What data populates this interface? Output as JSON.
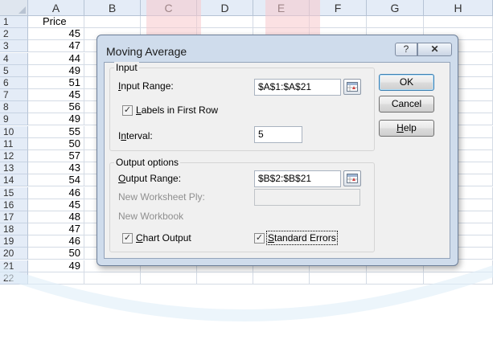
{
  "sheet": {
    "columns": [
      "A",
      "B",
      "C",
      "D",
      "E",
      "F",
      "G",
      "H"
    ],
    "rows": [
      "1",
      "2",
      "3",
      "4",
      "5",
      "6",
      "7",
      "8",
      "9",
      "10",
      "11",
      "12",
      "13",
      "14",
      "15",
      "16",
      "17",
      "18",
      "19",
      "20",
      "21",
      "22"
    ],
    "column_a": [
      "Price",
      "45",
      "47",
      "44",
      "49",
      "51",
      "45",
      "56",
      "49",
      "55",
      "50",
      "57",
      "43",
      "54",
      "46",
      "45",
      "48",
      "47",
      "46",
      "50",
      "49",
      ""
    ]
  },
  "dialog": {
    "title": "Moving Average",
    "help_glyph": "?",
    "close_glyph": "✕",
    "input": {
      "group_label": "Input",
      "range_label": "Input Range:",
      "range_value": "$A$1:$A$21",
      "labels_first_row_label": "Labels in First Row",
      "labels_first_row_checked": true,
      "interval_label": "Interval:",
      "interval_value": "5"
    },
    "output": {
      "group_label": "Output options",
      "range_label": "Output Range:",
      "range_value": "$B$2:$B$21",
      "new_ply_label": "New Worksheet Ply:",
      "new_workbook_label": "New Workbook",
      "chart_output_label": "Chart Output",
      "chart_output_checked": true,
      "std_errors_label": "Standard Errors",
      "std_errors_checked": true
    },
    "buttons": {
      "ok": "OK",
      "cancel": "Cancel",
      "help": "Help"
    },
    "check_glyph": "✓",
    "icons": {
      "help": "help-icon",
      "close": "close-icon",
      "collapse": "range-collapse-icon"
    }
  },
  "colors": {
    "header_bg": "#e4ecf7",
    "dialog_frame": "#cfdcec",
    "client_bg": "#f0f0f0",
    "default_button_border": "#3c7fb1"
  }
}
